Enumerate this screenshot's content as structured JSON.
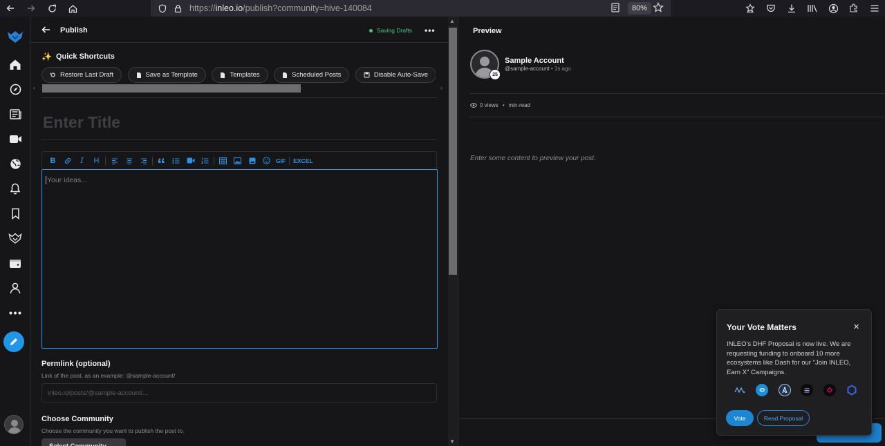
{
  "browser": {
    "url_prefix": "https://",
    "url_host": "inleo.io",
    "url_path": "/publish?community=hive-140084",
    "zoom": "80%"
  },
  "sidebar": {
    "items": [
      "logo-icon",
      "home-icon",
      "compass-icon",
      "newspaper-icon",
      "video-icon",
      "globe-icon",
      "bell-icon",
      "bookmark-icon",
      "leo-icon",
      "wallet-icon",
      "user-icon",
      "more-icon"
    ]
  },
  "editor": {
    "header_title": "Publish",
    "saving_status": "Saving Drafts",
    "quick_shortcuts_title": "Quick Shortcuts",
    "shortcuts": [
      "Restore Last Draft",
      "Save as Template",
      "Templates",
      "Scheduled Posts",
      "Disable Auto-Save"
    ],
    "title_placeholder": "Enter Title",
    "toolbar_gif": "GIF",
    "toolbar_excel": "EXCEL",
    "body_placeholder": "Your ideas...",
    "permlink_label": "Permlink (optional)",
    "permlink_hint": "Link of the post, as an example: @sample-account/",
    "permlink_placeholder": "inleo.io/posts/@sample-account/...",
    "community_label": "Choose Community",
    "community_hint": "Choose the community you want to publish the post to.",
    "community_button": "Select Community"
  },
  "preview": {
    "title": "Preview",
    "author_name": "Sample Account",
    "author_handle": "@sample-account",
    "time": "1s ago",
    "reputation": "25",
    "views": "0 views",
    "read_time": "min-read",
    "empty_message": "Enter some content to preview your post."
  },
  "popup": {
    "title": "Your Vote Matters",
    "body": "INLEO's DHF Proposal is now live. We are requesting funding to onboard 10 more ecosystems like Dash for our \"Join INLEO, Earn X\" Campaigns.",
    "vote_button": "Vote",
    "read_button": "Read Proposal"
  },
  "colors": {
    "accent": "#2b93e6",
    "saving_green": "#4fc27c",
    "background": "#161618"
  }
}
